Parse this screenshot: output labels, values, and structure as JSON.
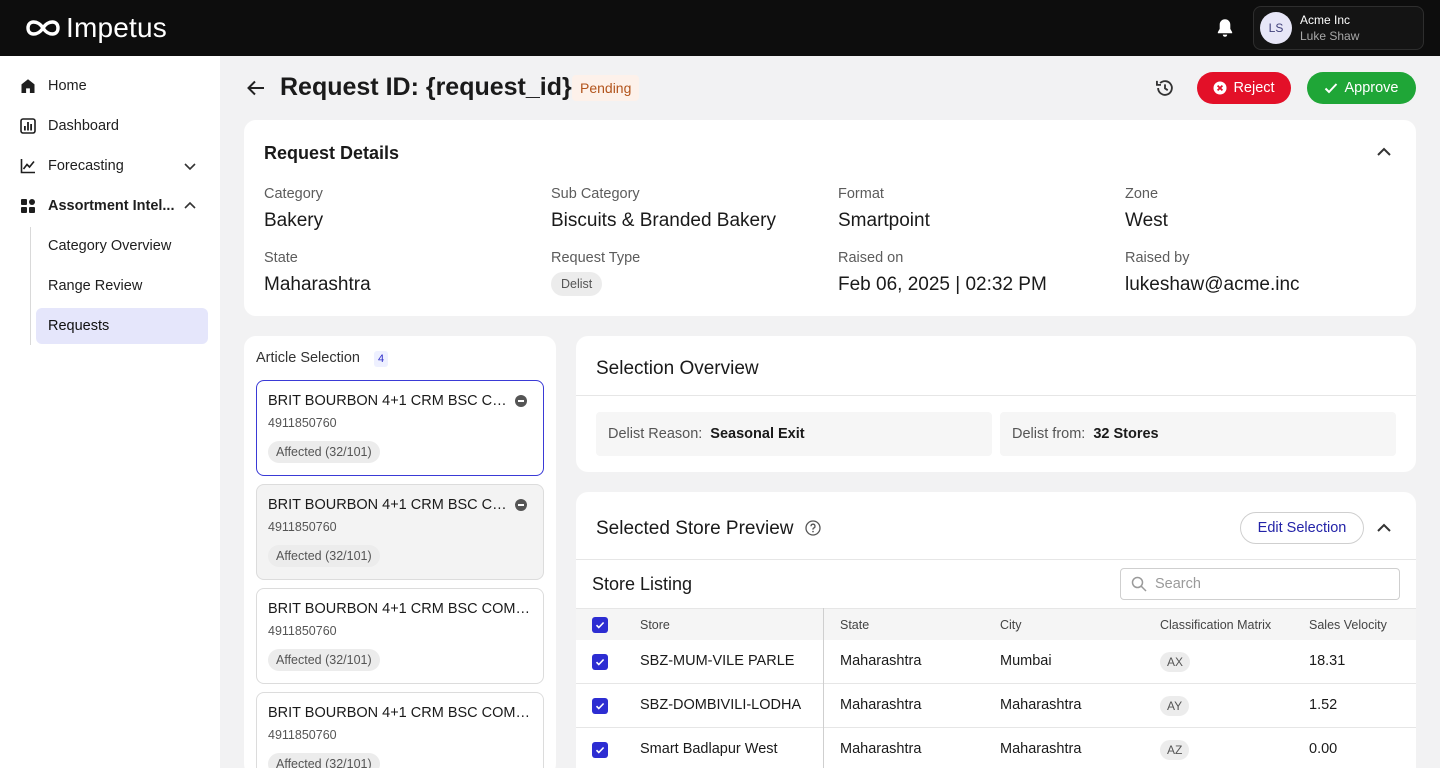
{
  "app": {
    "brand": "Impetus"
  },
  "account": {
    "initials": "LS",
    "org": "Acme Inc",
    "user": "Luke Shaw"
  },
  "sidebar": {
    "items": [
      {
        "label": "Home",
        "icon": "home-icon"
      },
      {
        "label": "Dashboard",
        "icon": "bar-chart-icon"
      },
      {
        "label": "Forecasting",
        "icon": "line-chart-icon"
      },
      {
        "label": "Assortment Intel...",
        "icon": "grid-icon"
      }
    ],
    "subitems": [
      {
        "label": "Category Overview"
      },
      {
        "label": "Range Review"
      },
      {
        "label": "Requests"
      }
    ]
  },
  "header": {
    "title": "Request ID: {request_id}",
    "status": "Pending",
    "reject_label": "Reject",
    "approve_label": "Approve"
  },
  "details": {
    "title": "Request Details",
    "category_label": "Category",
    "category": "Bakery",
    "subcategory_label": "Sub Category",
    "subcategory": "Biscuits & Branded Bakery",
    "format_label": "Format",
    "format": "Smartpoint",
    "zone_label": "Zone",
    "zone": "West",
    "state_label": "State",
    "state": "Maharashtra",
    "request_type_label": "Request Type",
    "request_type": "Delist",
    "raised_on_label": "Raised on",
    "raised_on": "Feb 06, 2025 | 02:32 PM",
    "raised_by_label": "Raised by",
    "raised_by": "lukeshaw@acme.inc"
  },
  "articles": {
    "title": "Article Selection",
    "count": "4",
    "items": [
      {
        "name": "BRIT BOURBON 4+1 CRM BSC CO...",
        "code": "4911850760",
        "affected": "Affected (32/101)"
      },
      {
        "name": "BRIT BOURBON 4+1 CRM BSC CO...",
        "code": "4911850760",
        "affected": "Affected (32/101)"
      },
      {
        "name": "BRIT BOURBON 4+1 CRM BSC COMB...",
        "code": "4911850760",
        "affected": "Affected (32/101)"
      },
      {
        "name": "BRIT BOURBON 4+1 CRM BSC COMB...",
        "code": "4911850760",
        "affected": "Affected (32/101)"
      }
    ]
  },
  "overview": {
    "title": "Selection Overview",
    "reason_label": "Delist Reason:",
    "reason": "Seasonal Exit",
    "from_label": "Delist from:",
    "from": "32 Stores"
  },
  "store_preview": {
    "title": "Selected Store Preview",
    "edit_label": "Edit Selection",
    "listing_title": "Store Listing",
    "search_placeholder": "Search",
    "columns": [
      "Store",
      "State",
      "City",
      "Classification Matrix",
      "Sales Velocity"
    ],
    "rows": [
      {
        "store": "SBZ-MUM-VILE PARLE",
        "state": "Maharashtra",
        "city": "Mumbai",
        "class": "AX",
        "velocity": "18.31"
      },
      {
        "store": "SBZ-DOMBIVILI-LODHA",
        "state": "Maharashtra",
        "city": "Maharashtra",
        "class": "AY",
        "velocity": "1.52"
      },
      {
        "store": "Smart Badlapur West",
        "state": "Maharashtra",
        "city": "Maharashtra",
        "class": "AZ",
        "velocity": "0.00"
      }
    ]
  },
  "colors": {
    "accent": "#2d2dd2",
    "reject": "#e31028",
    "approve": "#1fa637",
    "topbar": "#0d0d0d"
  }
}
